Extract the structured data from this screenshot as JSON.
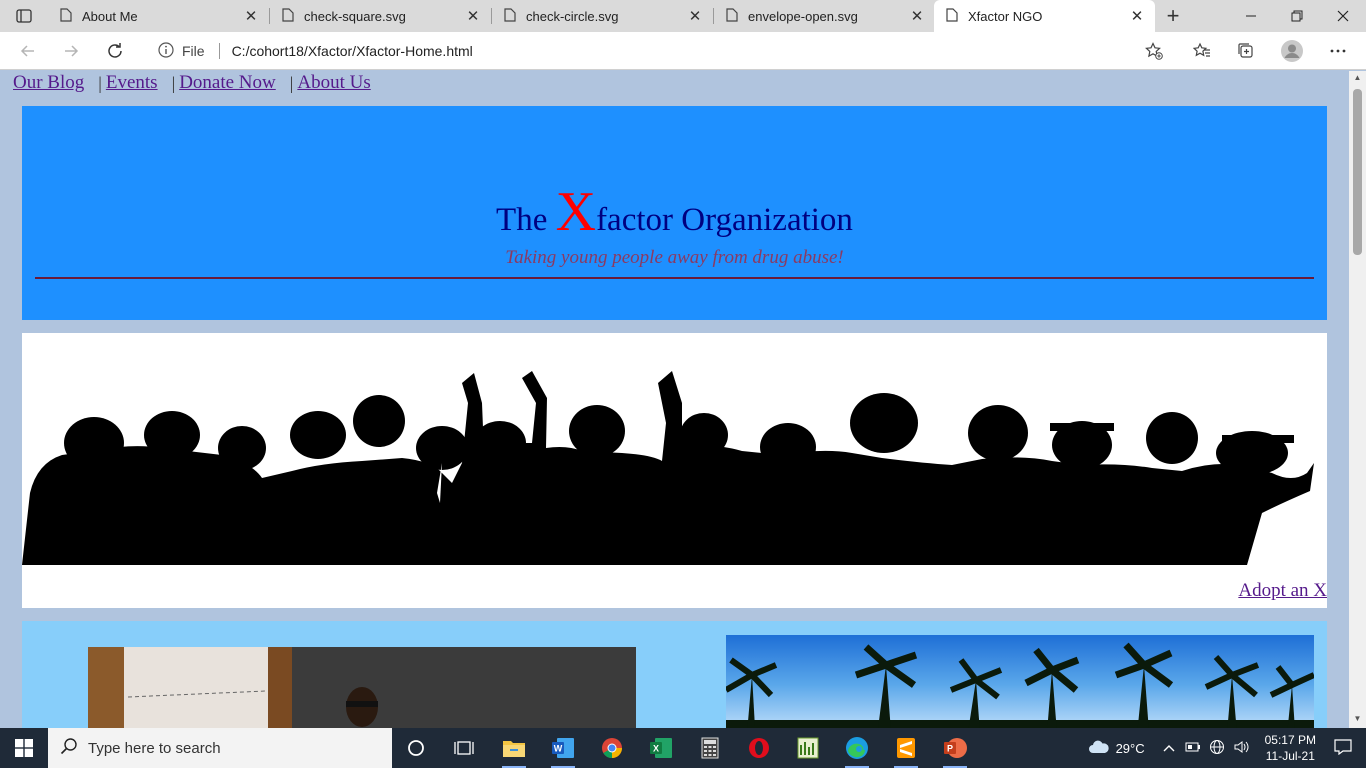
{
  "browser": {
    "tabs": [
      {
        "title": "About Me",
        "active": false
      },
      {
        "title": "check-square.svg",
        "active": false
      },
      {
        "title": "check-circle.svg",
        "active": false
      },
      {
        "title": "envelope-open.svg",
        "active": false
      },
      {
        "title": "Xfactor NGO",
        "active": true
      }
    ],
    "address": {
      "protocol_label": "File",
      "url": "C:/cohort18/Xfactor/Xfactor-Home.html"
    },
    "icons": [
      "tab-actions-icon",
      "page-icon",
      "close-icon",
      "plus-icon",
      "minimize-icon",
      "restore-icon",
      "close-window-icon",
      "back-icon",
      "forward-icon",
      "refresh-icon",
      "info-icon",
      "add-favorite-icon",
      "favorites-icon",
      "collections-icon",
      "profile-icon",
      "more-icon"
    ]
  },
  "page": {
    "nav": [
      {
        "label": "Our Blog"
      },
      {
        "label": "Events"
      },
      {
        "label": "Donate Now"
      },
      {
        "label": "About Us"
      }
    ],
    "nav_separator": "|",
    "header": {
      "title_prefix": "The",
      "title_x": "X",
      "title_suffix": "factor Organization",
      "tagline": "Taking young people away from drug abuse!"
    },
    "adopt_link": "Adopt an X",
    "colors": {
      "page_bg": "#b0c4de",
      "header_bg": "#1e90ff",
      "title": "#000080",
      "title_x": "#ff0000",
      "tagline": "#8b3a62",
      "gallery_bg": "#87cefa",
      "link": "#551a8b"
    }
  },
  "taskbar": {
    "search_placeholder": "Type here to search",
    "weather": "29°C",
    "time": "05:17 PM",
    "date": "11-Jul-21",
    "apps": [
      "cortana-icon",
      "task-view-icon",
      "file-explorer-icon",
      "word-icon",
      "chrome-icon",
      "excel-icon",
      "calculator-icon",
      "opera-icon",
      "project-icon",
      "edge-icon",
      "sublime-icon",
      "powerpoint-icon"
    ]
  }
}
